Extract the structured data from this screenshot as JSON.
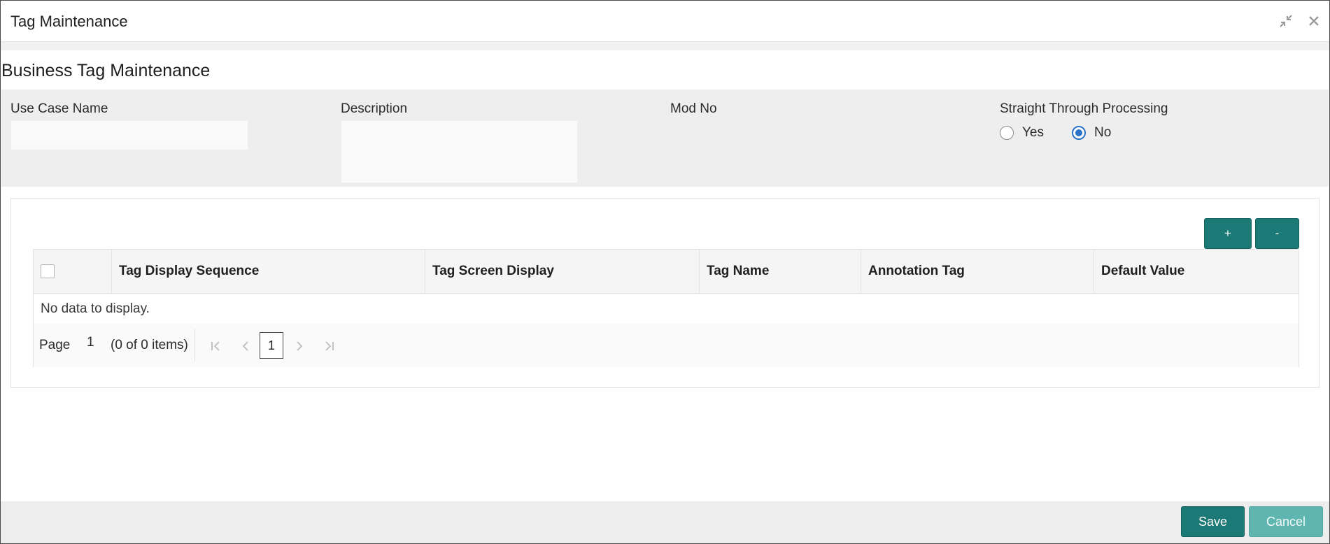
{
  "window": {
    "title": "Tag Maintenance",
    "controls": [
      {
        "name": "minimize-icon",
        "label": "↙"
      },
      {
        "name": "close-icon",
        "label": "✕"
      }
    ]
  },
  "page": {
    "title": "Business Tag Maintenance"
  },
  "form": {
    "use_case_name": {
      "label": "Use Case Name",
      "value": "",
      "placeholder": ""
    },
    "description": {
      "label": "Description",
      "value": "",
      "placeholder": ""
    },
    "mod_no": {
      "label": "Mod No",
      "value": ""
    },
    "stp": {
      "label": "Straight Through Processing",
      "options": [
        {
          "label": "Yes",
          "checked": false
        },
        {
          "label": "No",
          "checked": true
        }
      ]
    }
  },
  "grid": {
    "add_label": "+",
    "remove_label": "-",
    "columns": [
      "Tag Display Sequence",
      "Tag Screen Display",
      "Tag Name",
      "Annotation Tag",
      "Default Value"
    ],
    "rows": [],
    "empty_text": "No data to display.",
    "pager": {
      "page_label": "Page",
      "page_value": "1",
      "items_text": "(0 of 0 items)",
      "current_page": "1"
    }
  },
  "footer": {
    "save_label": "Save",
    "cancel_label": "Cancel"
  },
  "colors": {
    "accent": "#1c7a76",
    "accent_light": "#5fb5b0",
    "radio": "#2a73c8"
  }
}
